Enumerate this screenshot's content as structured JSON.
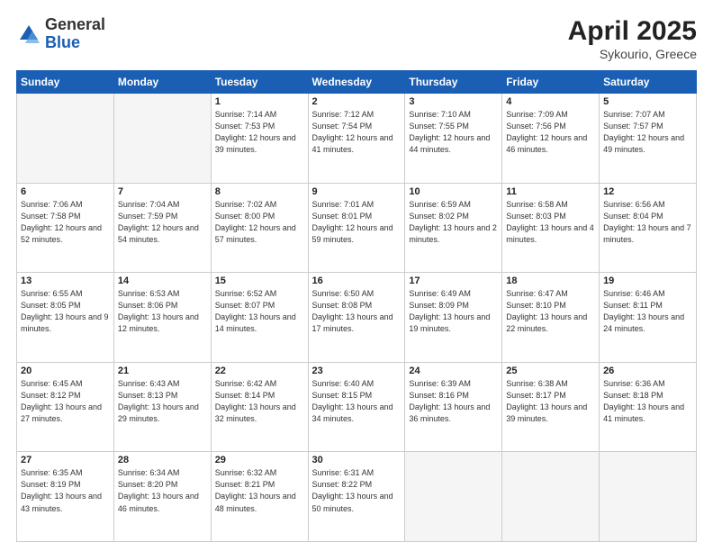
{
  "header": {
    "logo_general": "General",
    "logo_blue": "Blue",
    "title": "April 2025",
    "location": "Sykourio, Greece"
  },
  "weekdays": [
    "Sunday",
    "Monday",
    "Tuesday",
    "Wednesday",
    "Thursday",
    "Friday",
    "Saturday"
  ],
  "weeks": [
    [
      {
        "day": "",
        "info": ""
      },
      {
        "day": "",
        "info": ""
      },
      {
        "day": "1",
        "info": "Sunrise: 7:14 AM\nSunset: 7:53 PM\nDaylight: 12 hours and 39 minutes."
      },
      {
        "day": "2",
        "info": "Sunrise: 7:12 AM\nSunset: 7:54 PM\nDaylight: 12 hours and 41 minutes."
      },
      {
        "day": "3",
        "info": "Sunrise: 7:10 AM\nSunset: 7:55 PM\nDaylight: 12 hours and 44 minutes."
      },
      {
        "day": "4",
        "info": "Sunrise: 7:09 AM\nSunset: 7:56 PM\nDaylight: 12 hours and 46 minutes."
      },
      {
        "day": "5",
        "info": "Sunrise: 7:07 AM\nSunset: 7:57 PM\nDaylight: 12 hours and 49 minutes."
      }
    ],
    [
      {
        "day": "6",
        "info": "Sunrise: 7:06 AM\nSunset: 7:58 PM\nDaylight: 12 hours and 52 minutes."
      },
      {
        "day": "7",
        "info": "Sunrise: 7:04 AM\nSunset: 7:59 PM\nDaylight: 12 hours and 54 minutes."
      },
      {
        "day": "8",
        "info": "Sunrise: 7:02 AM\nSunset: 8:00 PM\nDaylight: 12 hours and 57 minutes."
      },
      {
        "day": "9",
        "info": "Sunrise: 7:01 AM\nSunset: 8:01 PM\nDaylight: 12 hours and 59 minutes."
      },
      {
        "day": "10",
        "info": "Sunrise: 6:59 AM\nSunset: 8:02 PM\nDaylight: 13 hours and 2 minutes."
      },
      {
        "day": "11",
        "info": "Sunrise: 6:58 AM\nSunset: 8:03 PM\nDaylight: 13 hours and 4 minutes."
      },
      {
        "day": "12",
        "info": "Sunrise: 6:56 AM\nSunset: 8:04 PM\nDaylight: 13 hours and 7 minutes."
      }
    ],
    [
      {
        "day": "13",
        "info": "Sunrise: 6:55 AM\nSunset: 8:05 PM\nDaylight: 13 hours and 9 minutes."
      },
      {
        "day": "14",
        "info": "Sunrise: 6:53 AM\nSunset: 8:06 PM\nDaylight: 13 hours and 12 minutes."
      },
      {
        "day": "15",
        "info": "Sunrise: 6:52 AM\nSunset: 8:07 PM\nDaylight: 13 hours and 14 minutes."
      },
      {
        "day": "16",
        "info": "Sunrise: 6:50 AM\nSunset: 8:08 PM\nDaylight: 13 hours and 17 minutes."
      },
      {
        "day": "17",
        "info": "Sunrise: 6:49 AM\nSunset: 8:09 PM\nDaylight: 13 hours and 19 minutes."
      },
      {
        "day": "18",
        "info": "Sunrise: 6:47 AM\nSunset: 8:10 PM\nDaylight: 13 hours and 22 minutes."
      },
      {
        "day": "19",
        "info": "Sunrise: 6:46 AM\nSunset: 8:11 PM\nDaylight: 13 hours and 24 minutes."
      }
    ],
    [
      {
        "day": "20",
        "info": "Sunrise: 6:45 AM\nSunset: 8:12 PM\nDaylight: 13 hours and 27 minutes."
      },
      {
        "day": "21",
        "info": "Sunrise: 6:43 AM\nSunset: 8:13 PM\nDaylight: 13 hours and 29 minutes."
      },
      {
        "day": "22",
        "info": "Sunrise: 6:42 AM\nSunset: 8:14 PM\nDaylight: 13 hours and 32 minutes."
      },
      {
        "day": "23",
        "info": "Sunrise: 6:40 AM\nSunset: 8:15 PM\nDaylight: 13 hours and 34 minutes."
      },
      {
        "day": "24",
        "info": "Sunrise: 6:39 AM\nSunset: 8:16 PM\nDaylight: 13 hours and 36 minutes."
      },
      {
        "day": "25",
        "info": "Sunrise: 6:38 AM\nSunset: 8:17 PM\nDaylight: 13 hours and 39 minutes."
      },
      {
        "day": "26",
        "info": "Sunrise: 6:36 AM\nSunset: 8:18 PM\nDaylight: 13 hours and 41 minutes."
      }
    ],
    [
      {
        "day": "27",
        "info": "Sunrise: 6:35 AM\nSunset: 8:19 PM\nDaylight: 13 hours and 43 minutes."
      },
      {
        "day": "28",
        "info": "Sunrise: 6:34 AM\nSunset: 8:20 PM\nDaylight: 13 hours and 46 minutes."
      },
      {
        "day": "29",
        "info": "Sunrise: 6:32 AM\nSunset: 8:21 PM\nDaylight: 13 hours and 48 minutes."
      },
      {
        "day": "30",
        "info": "Sunrise: 6:31 AM\nSunset: 8:22 PM\nDaylight: 13 hours and 50 minutes."
      },
      {
        "day": "",
        "info": ""
      },
      {
        "day": "",
        "info": ""
      },
      {
        "day": "",
        "info": ""
      }
    ]
  ]
}
